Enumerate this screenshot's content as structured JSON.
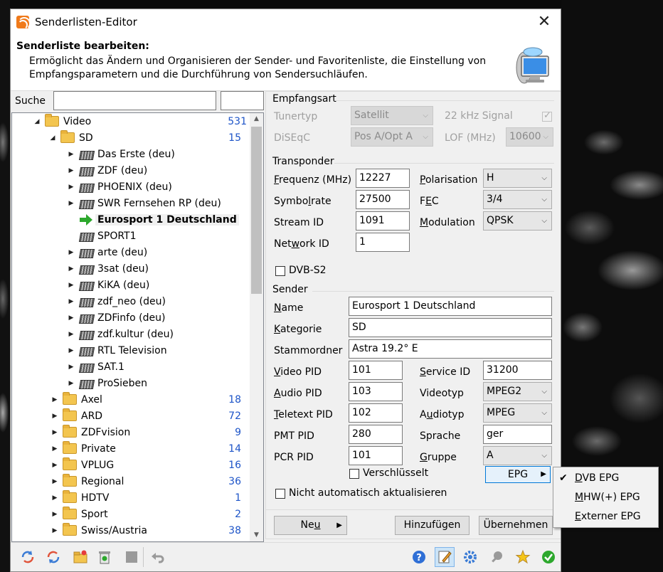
{
  "window": {
    "title": "Senderlisten-Editor",
    "close_glyph": "✕"
  },
  "header": {
    "title": "Senderliste bearbeiten:",
    "description": "Ermöglicht das Ändern und Organisieren der Sender- und Favoritenliste, die Einstellung von Empfangsparametern und die Durchführung von Sendersuchläufen."
  },
  "search": {
    "label": "Suche",
    "value": "",
    "value2": ""
  },
  "tree": {
    "video": {
      "label": "Video",
      "count": "531"
    },
    "sd": {
      "label": "SD",
      "count": "15"
    },
    "channels": [
      {
        "label": "Das Erste (deu)"
      },
      {
        "label": "ZDF (deu)"
      },
      {
        "label": "PHOENIX (deu)"
      },
      {
        "label": "SWR Fernsehen RP (deu)"
      },
      {
        "label": "Eurosport 1 Deutschland"
      },
      {
        "label": "SPORT1"
      },
      {
        "label": "arte (deu)"
      },
      {
        "label": "3sat (deu)"
      },
      {
        "label": "KiKA (deu)"
      },
      {
        "label": "zdf_neo (deu)"
      },
      {
        "label": "ZDFinfo (deu)"
      },
      {
        "label": "zdf.kultur (deu)"
      },
      {
        "label": "RTL Television"
      },
      {
        "label": "SAT.1"
      },
      {
        "label": "ProSieben"
      }
    ],
    "folders": [
      {
        "label": "Axel",
        "count": "18"
      },
      {
        "label": "ARD",
        "count": "72"
      },
      {
        "label": "ZDFvision",
        "count": "9"
      },
      {
        "label": "Private",
        "count": "14"
      },
      {
        "label": "VPLUG",
        "count": "16"
      },
      {
        "label": "Regional",
        "count": "36"
      },
      {
        "label": "HDTV",
        "count": "1"
      },
      {
        "label": "Sport",
        "count": "2"
      },
      {
        "label": "Swiss/Austria",
        "count": "38"
      }
    ]
  },
  "empfangsart": {
    "title": "Empfangsart",
    "tunertyp_label": "Tunertyp",
    "tunertyp_value": "Satellit",
    "signal_label": "22 kHz Signal",
    "diseqc_label": "DiSEqC",
    "diseqc_value": "Pos A/Opt A",
    "lof_label": "LOF  (MHz)",
    "lof_value": "10600"
  },
  "transponder": {
    "title": "Transponder",
    "frequenz_label_u": "F",
    "frequenz_label_rest": "requenz (MHz)",
    "frequenz_value": "12227",
    "symbolrate_label_pre": "Symbo",
    "symbolrate_label_u": "l",
    "symbolrate_label_rest": "rate",
    "symbolrate_value": "27500",
    "streamid_label": "Stream ID",
    "streamid_value": "1091",
    "networkid_label_pre": "Net",
    "networkid_label_u": "w",
    "networkid_label_rest": "ork ID",
    "networkid_value": "1",
    "polarisation_label_u": "P",
    "polarisation_label_rest": "olarisation",
    "polarisation_value": "H",
    "fec_label_pre": "F",
    "fec_label_u": "E",
    "fec_label_rest": "C",
    "fec_value": "3/4",
    "modulation_label_u": "M",
    "modulation_label_rest": "odulation",
    "modulation_value": "QPSK",
    "dvbs2_label": "DVB-S2"
  },
  "sender": {
    "title": "Sender",
    "name_label_u": "N",
    "name_label_rest": "ame",
    "name_value": "Eurosport 1 Deutschland",
    "kategorie_label_u": "K",
    "kategorie_label_rest": "ategorie",
    "kategorie_value": "SD",
    "stammordner_label": "Stammordner",
    "stammordner_value": "Astra 19.2° E",
    "videopid_label_u": "V",
    "videopid_label_rest": "ideo PID",
    "videopid_value": "101",
    "audiopid_label_u": "A",
    "audiopid_label_rest": "udio PID",
    "audiopid_value": "103",
    "teletextpid_label_u": "T",
    "teletextpid_label_rest": "eletext PID",
    "teletextpid_value": "102",
    "pmtpid_label": "PMT PID",
    "pmtpid_value": "280",
    "pcrpid_label": "PCR PID",
    "pcrpid_value": "101",
    "serviceid_label_u": "S",
    "serviceid_label_rest": "ervice ID",
    "serviceid_value": "31200",
    "videotyp_label": "Videotyp",
    "videotyp_value": "MPEG2",
    "audiotyp_label_pre": "A",
    "audiotyp_label_u": "u",
    "audiotyp_label_rest": "diotyp",
    "audiotyp_value": "MPEG",
    "sprache_label": "Sprache",
    "sprache_value": "ger",
    "gruppe_label_u": "G",
    "gruppe_label_rest": "ruppe",
    "gruppe_value": "A",
    "verschluesselt_label": "Verschlüsselt",
    "epg_button": "EPG",
    "nicht_auto_label": "Nicht automatisch aktualisieren"
  },
  "buttons": {
    "neu_pre": "Ne",
    "neu_u": "u",
    "hinzufuegen": "Hinzufügen",
    "uebernehmen": "Übernehmen"
  },
  "epg_menu": {
    "items": [
      {
        "pre": "",
        "u": "D",
        "rest": "VB EPG",
        "checked": true
      },
      {
        "pre": "",
        "u": "M",
        "rest": "HW(+) EPG",
        "checked": false
      },
      {
        "pre": "",
        "u": "E",
        "rest": "xterner EPG",
        "checked": false
      }
    ],
    "check_glyph": "✔"
  },
  "toolbar_icons": [
    "refresh-icon",
    "refresh-alt-icon",
    "new-folder-icon",
    "delete-icon",
    "stop-icon",
    "undo-icon",
    "help-icon",
    "edit-icon",
    "settings-icon",
    "search-icon",
    "favorite-icon",
    "confirm-icon"
  ],
  "colors": {
    "count_blue": "#1d54c8",
    "arrow_green": "#2da82d",
    "folder_yellow": "#f3c54f"
  }
}
